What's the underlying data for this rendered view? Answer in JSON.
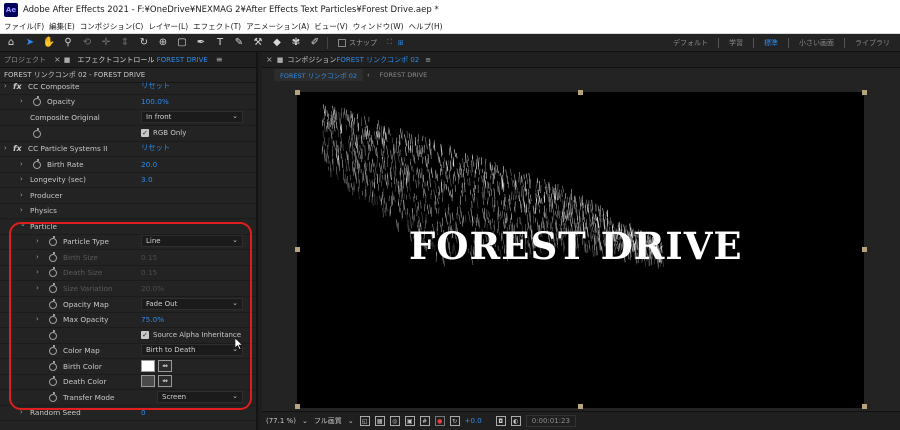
{
  "app": {
    "icon_text": "Ae",
    "title": "Adobe After Effects 2021 - F:¥OneDrive¥NEXMAG 2¥After Effects Text Particles¥Forest Drive.aep *"
  },
  "menu": [
    "ファイル(F)",
    "編集(E)",
    "コンポジション(C)",
    "レイヤー(L)",
    "エフェクト(T)",
    "アニメーション(A)",
    "ビュー(V)",
    "ウィンドウ(W)",
    "ヘルプ(H)"
  ],
  "toolbar": {
    "tools": [
      {
        "name": "home-icon",
        "glyph": "⌂",
        "state": "normal"
      },
      {
        "name": "selection-tool-icon",
        "glyph": "➤",
        "state": "active"
      },
      {
        "name": "hand-tool-icon",
        "glyph": "✋",
        "state": "normal"
      },
      {
        "name": "zoom-tool-icon",
        "glyph": "⚲",
        "state": "normal"
      },
      {
        "name": "orbit-tool-icon",
        "glyph": "⟲",
        "state": "dim"
      },
      {
        "name": "pan-tool-icon",
        "glyph": "✛",
        "state": "dim"
      },
      {
        "name": "dolly-tool-icon",
        "glyph": "⇕",
        "state": "dim"
      },
      {
        "name": "rotate-tool-icon",
        "glyph": "↻",
        "state": "normal"
      },
      {
        "name": "anchor-tool-icon",
        "glyph": "⊕",
        "state": "normal"
      },
      {
        "name": "rectangle-tool-icon",
        "glyph": "▢",
        "state": "normal"
      },
      {
        "name": "pen-tool-icon",
        "glyph": "✒",
        "state": "normal"
      },
      {
        "name": "type-tool-icon",
        "glyph": "T",
        "state": "normal"
      },
      {
        "name": "brush-tool-icon",
        "glyph": "✎",
        "state": "normal"
      },
      {
        "name": "clone-stamp-tool-icon",
        "glyph": "⚒",
        "state": "normal"
      },
      {
        "name": "eraser-tool-icon",
        "glyph": "◆",
        "state": "normal"
      },
      {
        "name": "roto-brush-tool-icon",
        "glyph": "✾",
        "state": "normal"
      },
      {
        "name": "puppet-pin-tool-icon",
        "glyph": "✐",
        "state": "normal"
      }
    ],
    "snap_label": "スナップ",
    "workspaces": [
      "デフォルト",
      "学習",
      "標準",
      "小さい画面",
      "ライブラリ"
    ],
    "active_workspace": "標準"
  },
  "left_panel": {
    "tab_project": "プロジェクト",
    "tab_effect_controls_prefix": "エフェクトコントロール",
    "tab_effect_controls_layer": "FOREST DRIVE",
    "header": "FOREST リンクコンポ 02 - FOREST DRIVE",
    "reset_label": "リセット",
    "rows": {
      "cc_composite": "CC Composite",
      "opacity_label": "Opacity",
      "opacity_value": "100.0%",
      "composite_original_label": "Composite Original",
      "composite_original_value": "In front",
      "rgb_only_label": "RGB Only",
      "cc_particle": "CC Particle Systems II",
      "birth_rate_label": "Birth Rate",
      "birth_rate_value": "20.0",
      "longevity_label": "Longevity (sec)",
      "longevity_value": "3.0",
      "producer_label": "Producer",
      "physics_label": "Physics",
      "particle_label": "Particle",
      "particle_type_label": "Particle Type",
      "particle_type_value": "Line",
      "birth_size_label": "Birth Size",
      "birth_size_value": "0.15",
      "death_size_label": "Death Size",
      "death_size_value": "0.15",
      "size_variation_label": "Size Variation",
      "size_variation_value": "20.0%",
      "opacity_map_label": "Opacity Map",
      "opacity_map_value": "Fade Out",
      "max_opacity_label": "Max Opacity",
      "max_opacity_value": "75.0%",
      "source_alpha_label": "Source Alpha Inheritance",
      "color_map_label": "Color Map",
      "color_map_value": "Birth to Death",
      "birth_color_label": "Birth Color",
      "birth_color": "#ffffff",
      "death_color_label": "Death Color",
      "death_color": "#4a4a4a",
      "transfer_mode_label": "Transfer Mode",
      "transfer_mode_value": "Screen",
      "random_seed_label": "Random Seed",
      "random_seed_value": "0"
    }
  },
  "right_panel": {
    "tab_prefix": "コンポジション",
    "tab_comp": "FOREST リンクコンポ 02",
    "subtab_active": "FOREST リンクコンポ 02",
    "subtab_other": "FOREST DRIVE",
    "headline": "FOREST DRIVE",
    "bottom": {
      "zoom": "(77.1 %)",
      "resolution": "フル画質",
      "exposure": "+0.0",
      "timecode": "0:00:01:23"
    }
  },
  "colors": {
    "accent": "#2d8ceb",
    "highlight_box": "#e01e1e"
  }
}
